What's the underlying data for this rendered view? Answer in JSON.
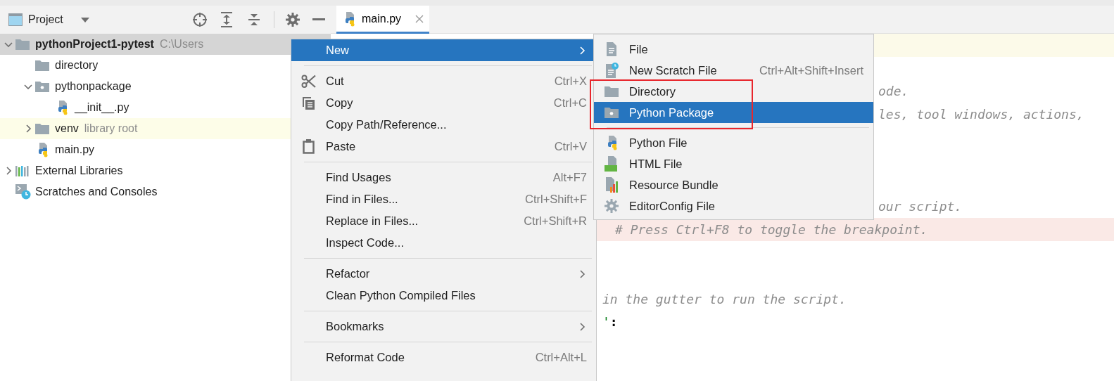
{
  "project_panel": {
    "title": "Project"
  },
  "tree": [
    {
      "label": "pythonProject1-pytest",
      "kind": "project-root",
      "hint": "C:\\Users",
      "selected": true,
      "highlighted": false,
      "expanded": true,
      "children": [
        {
          "label": "directory",
          "kind": "folder",
          "selected": false,
          "highlighted": false
        },
        {
          "label": "pythonpackage",
          "kind": "package",
          "selected": false,
          "highlighted": false,
          "expanded": true,
          "children": [
            {
              "label": "__init__.py",
              "kind": "python-file",
              "selected": false,
              "highlighted": false
            }
          ]
        },
        {
          "label": "venv",
          "kind": "folder",
          "hint": "library root",
          "selected": false,
          "highlighted": true,
          "expanded": false
        },
        {
          "label": "main.py",
          "kind": "python-file",
          "selected": false,
          "highlighted": false
        }
      ]
    },
    {
      "label": "External Libraries",
      "kind": "libraries",
      "selected": false,
      "highlighted": false,
      "expanded": false
    },
    {
      "label": "Scratches and Consoles",
      "kind": "scratches",
      "selected": false,
      "highlighted": false
    }
  ],
  "editor": {
    "tabs": [
      {
        "label": "main.py",
        "selected": true
      }
    ],
    "lines": [
      {
        "kind": "blank",
        "current": true
      },
      {
        "kind": "blank"
      },
      {
        "kind": "comment",
        "text": "ode."
      },
      {
        "kind": "comment",
        "text": "les, tool windows, actions,"
      },
      {
        "kind": "blank"
      },
      {
        "kind": "blank"
      },
      {
        "kind": "blank"
      },
      {
        "kind": "comment",
        "text": "our script."
      },
      {
        "kind": "comment",
        "text": "# Press Ctrl+F8 to toggle the breakpoint.",
        "breakpoint": true
      },
      {
        "kind": "blank"
      },
      {
        "kind": "blank"
      },
      {
        "kind": "comment",
        "text": "in the gutter to run the script."
      },
      {
        "kind": "code",
        "parts": [
          {
            "text": "'",
            "kind": "string"
          },
          {
            "text": ":",
            "kind": "plain"
          }
        ]
      }
    ]
  },
  "context_menu": {
    "groups": [
      [
        {
          "label": "New",
          "kind": "submenu",
          "selected": true
        }
      ],
      [
        {
          "label": "Cut",
          "shortcut": "Ctrl+X",
          "kind": "cut",
          "selected": false
        },
        {
          "label": "Copy",
          "shortcut": "Ctrl+C",
          "kind": "copy",
          "selected": false
        },
        {
          "label": "Copy Path/Reference...",
          "kind": "action",
          "selected": false
        },
        {
          "label": "Paste",
          "shortcut": "Ctrl+V",
          "kind": "paste",
          "selected": false
        }
      ],
      [
        {
          "label": "Find Usages",
          "shortcut": "Alt+F7",
          "kind": "action",
          "selected": false
        },
        {
          "label": "Find in Files...",
          "shortcut": "Ctrl+Shift+F",
          "kind": "action",
          "selected": false
        },
        {
          "label": "Replace in Files...",
          "shortcut": "Ctrl+Shift+R",
          "kind": "action",
          "selected": false
        },
        {
          "label": "Inspect Code...",
          "kind": "action",
          "selected": false
        }
      ],
      [
        {
          "label": "Refactor",
          "kind": "submenu",
          "selected": false
        },
        {
          "label": "Clean Python Compiled Files",
          "kind": "action",
          "selected": false
        }
      ],
      [
        {
          "label": "Bookmarks",
          "kind": "submenu",
          "selected": false
        }
      ],
      [
        {
          "label": "Reformat Code",
          "shortcut": "Ctrl+Alt+L",
          "kind": "action",
          "selected": false
        }
      ]
    ]
  },
  "submenu": {
    "groups": [
      [
        {
          "label": "File",
          "kind": "file",
          "selected": false,
          "framed": false
        },
        {
          "label": "New Scratch File",
          "shortcut": "Ctrl+Alt+Shift+Insert",
          "kind": "scratch",
          "selected": false,
          "framed": false
        },
        {
          "label": "Directory",
          "kind": "folder",
          "selected": false,
          "framed": true
        },
        {
          "label": "Python Package",
          "kind": "package",
          "selected": true,
          "framed": true
        }
      ],
      [
        {
          "label": "Python File",
          "kind": "python-file",
          "selected": false,
          "framed": false
        },
        {
          "label": "HTML File",
          "kind": "html-file",
          "selected": false,
          "framed": false
        },
        {
          "label": "Resource Bundle",
          "kind": "bundle",
          "selected": false,
          "framed": false
        },
        {
          "label": "EditorConfig File",
          "kind": "gear",
          "selected": false,
          "framed": false
        }
      ]
    ]
  }
}
